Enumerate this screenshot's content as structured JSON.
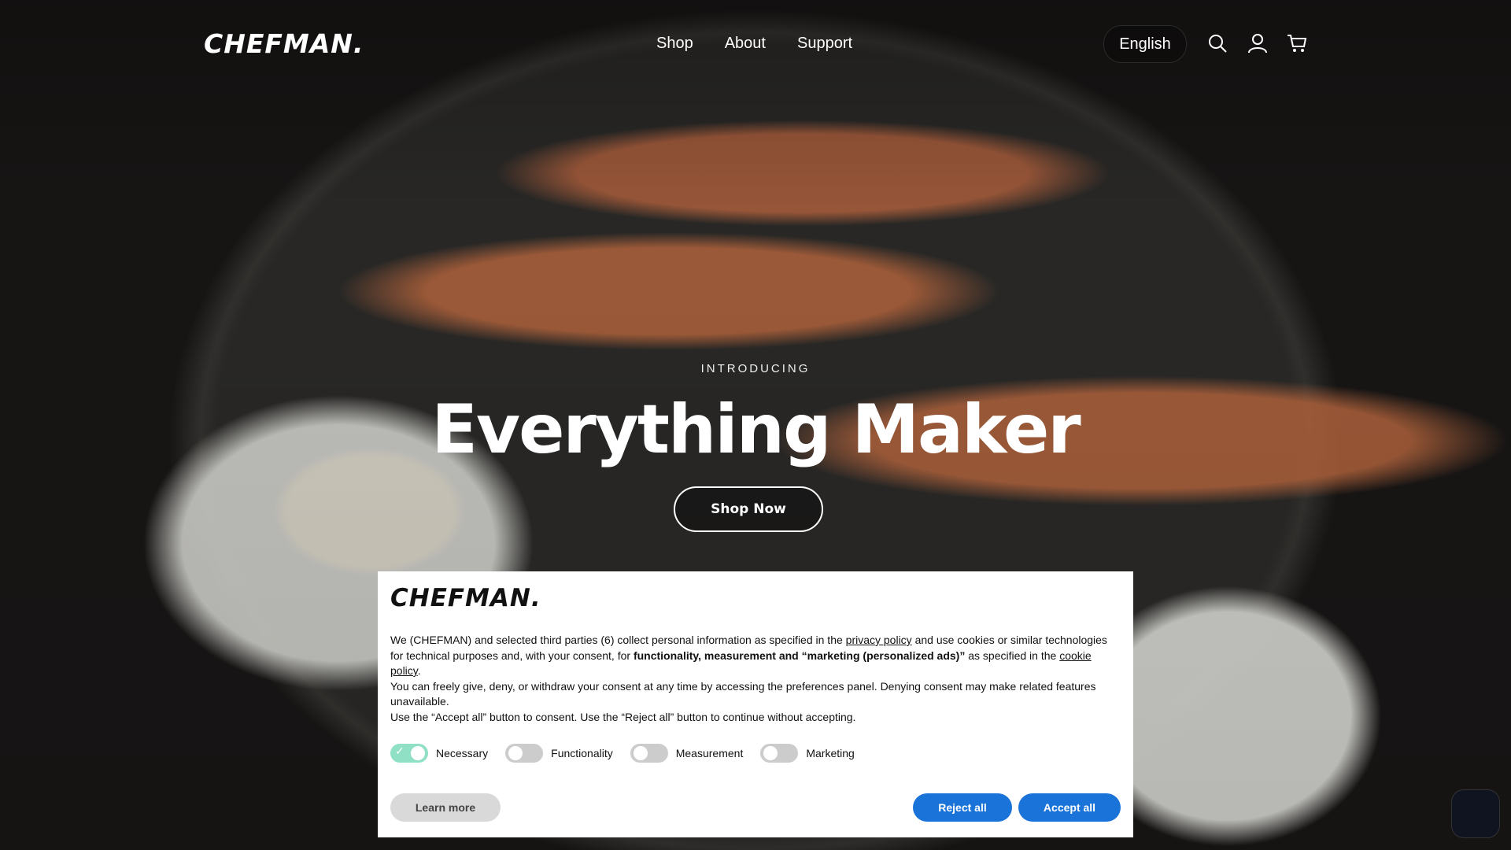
{
  "header": {
    "logo": "CHEFMAN.",
    "nav": [
      "Shop",
      "About",
      "Support"
    ],
    "language": "English",
    "icons": [
      "search-icon",
      "account-icon",
      "cart-icon"
    ]
  },
  "hero": {
    "eyebrow": "INTRODUCING",
    "headline": "Everything Maker",
    "cta": "Shop Now"
  },
  "cookie": {
    "logo": "CHEFMAN.",
    "p1_a": "We (CHEFMAN) and selected third parties (6) collect personal information as specified in the ",
    "privacy_link": "privacy policy",
    "p1_b": " and use cookies or similar technologies for technical purposes and, with your consent, for ",
    "p1_bold": "functionality, measurement and “marketing (personalized ads)”",
    "p1_c": " as specified in the ",
    "cookie_link": "cookie policy",
    "p1_d": ".",
    "p2": "You can freely give, deny, or withdraw your consent at any time by accessing the preferences panel. Denying consent may make related features unavailable.",
    "p3": "Use the “Accept all” button to consent. Use the “Reject all” button to continue without accepting.",
    "toggles": [
      {
        "label": "Necessary",
        "on": true
      },
      {
        "label": "Functionality",
        "on": false
      },
      {
        "label": "Measurement",
        "on": false
      },
      {
        "label": "Marketing",
        "on": false
      }
    ],
    "learn_more": "Learn more",
    "reject_all": "Reject all",
    "accept_all": "Accept all"
  },
  "colors": {
    "primary_button": "#1a73d9",
    "toggle_on": "#8fe0c4"
  }
}
